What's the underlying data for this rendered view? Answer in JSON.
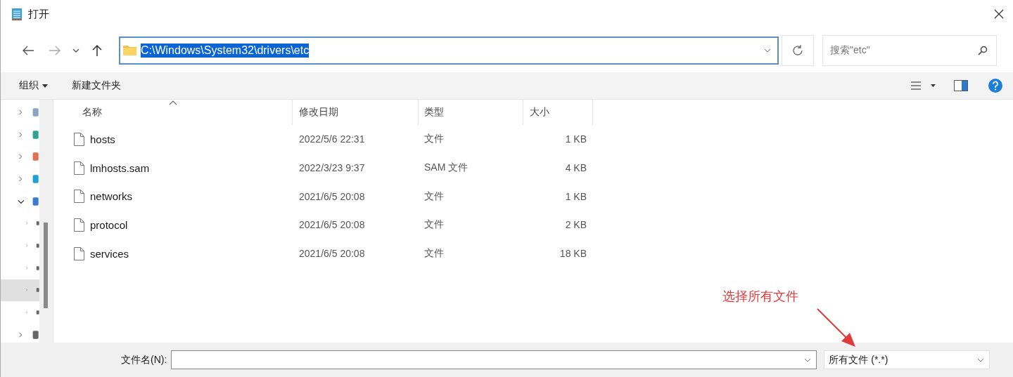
{
  "window": {
    "title": "打开"
  },
  "address": {
    "path": "C:\\Windows\\System32\\drivers\\etc",
    "selected": true
  },
  "search": {
    "placeholder": "搜索\"etc\""
  },
  "toolbar": {
    "organize": "组织",
    "new_folder": "新建文件夹"
  },
  "nav_tree": [
    {
      "expanded": false,
      "selected": false
    },
    {
      "expanded": false,
      "selected": false
    },
    {
      "expanded": false,
      "selected": false
    },
    {
      "expanded": false,
      "selected": false
    },
    {
      "expanded": true,
      "selected": false,
      "children": [
        {
          "expanded": false,
          "selected": false
        },
        {
          "expanded": false,
          "selected": false
        },
        {
          "expanded": false,
          "selected": false
        },
        {
          "expanded": false,
          "selected": true
        },
        {
          "expanded": false,
          "selected": false
        }
      ]
    },
    {
      "expanded": false,
      "selected": false
    }
  ],
  "table": {
    "columns": [
      {
        "label": "名称",
        "sorted": true
      },
      {
        "label": "修改日期",
        "sorted": false
      },
      {
        "label": "类型",
        "sorted": false
      },
      {
        "label": "大小",
        "sorted": false
      }
    ],
    "rows": [
      {
        "name": "hosts",
        "modified": "2022/5/6 22:31",
        "type": "文件",
        "size": "1 KB"
      },
      {
        "name": "lmhosts.sam",
        "modified": "2022/3/23 9:37",
        "type": "SAM 文件",
        "size": "4 KB"
      },
      {
        "name": "networks",
        "modified": "2021/6/5 20:08",
        "type": "文件",
        "size": "1 KB"
      },
      {
        "name": "protocol",
        "modified": "2021/6/5 20:08",
        "type": "文件",
        "size": "2 KB"
      },
      {
        "name": "services",
        "modified": "2021/6/5 20:08",
        "type": "文件",
        "size": "18 KB"
      }
    ]
  },
  "footer": {
    "filename_label": "文件名(N):",
    "file_type": "所有文件 (*.*)"
  },
  "annotation": {
    "text": "选择所有文件"
  }
}
